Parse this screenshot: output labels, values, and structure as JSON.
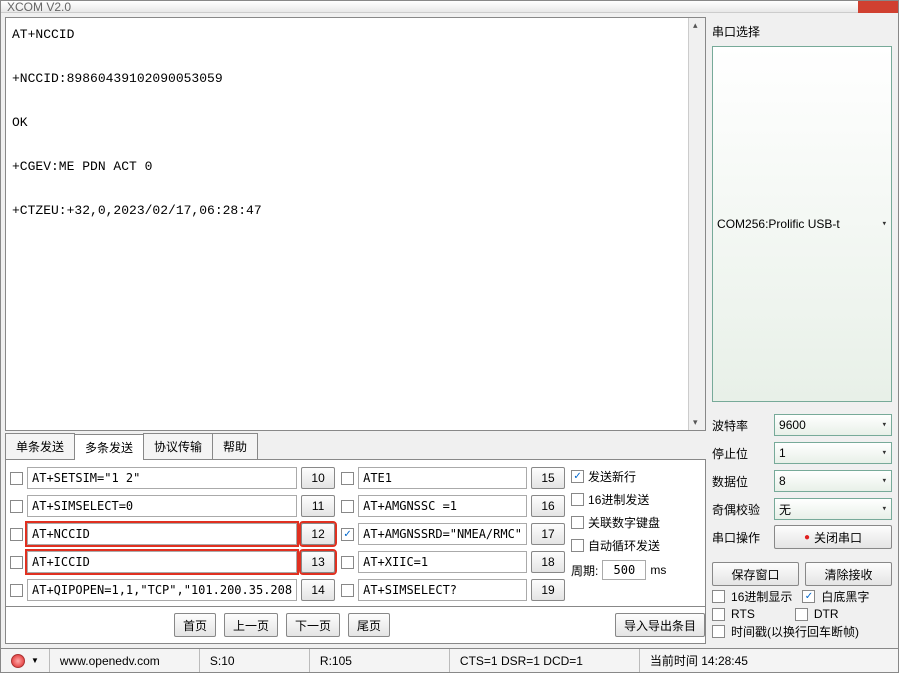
{
  "title": "XCOM V2.0",
  "output": {
    "lines": [
      "AT+NCCID",
      "+NCCID:89860439102090053059",
      "OK",
      "+CGEV:ME PDN ACT 0",
      "+CTZEU:+32,0,2023/02/17,06:28:47"
    ]
  },
  "right_panel": {
    "heading": "串口选择",
    "port": "COM256:Prolific USB-t",
    "baud_label": "波特率",
    "baud": "9600",
    "stop_label": "停止位",
    "stop": "1",
    "data_label": "数据位",
    "data": "8",
    "parity_label": "奇偶校验",
    "parity": "无",
    "op_label": "串口操作",
    "op_btn": "关闭串口",
    "save_btn": "保存窗口",
    "clear_btn": "清除接收",
    "hex_disp": "16进制显示",
    "white_bg": "白底黑字",
    "rts": "RTS",
    "dtr": "DTR",
    "timestamp": "时间戳(以换行回车断帧)"
  },
  "tabs": {
    "t0": "单条发送",
    "t1": "多条发送",
    "t2": "协议传输",
    "t3": "帮助"
  },
  "send": {
    "left": [
      {
        "cmd": "AT+SETSIM=\"1 2\"",
        "n": "10",
        "hl": false,
        "chk": false
      },
      {
        "cmd": "AT+SIMSELECT=0",
        "n": "11",
        "hl": false,
        "chk": false
      },
      {
        "cmd": "AT+NCCID",
        "n": "12",
        "hl": true,
        "chk": false
      },
      {
        "cmd": "AT+ICCID",
        "n": "13",
        "hl": true,
        "chk": false
      },
      {
        "cmd": "AT+QIPOPEN=1,1,\"TCP\",\"101.200.35.208",
        "n": "14",
        "hl": false,
        "chk": false
      }
    ],
    "right": [
      {
        "cmd": "ATE1",
        "n": "15",
        "hl": false,
        "chk": false
      },
      {
        "cmd": "AT+AMGNSSC =1",
        "n": "16",
        "hl": false,
        "chk": false
      },
      {
        "cmd": "AT+AMGNSSRD=\"NMEA/RMC\"",
        "n": "17",
        "hl": false,
        "chk": true
      },
      {
        "cmd": "AT+XIIC=1",
        "n": "18",
        "hl": false,
        "chk": false
      },
      {
        "cmd": "AT+SIMSELECT?",
        "n": "19",
        "hl": false,
        "chk": false
      }
    ]
  },
  "opts": {
    "newline": "发送新行",
    "hex_send": "16进制发送",
    "numpad": "关联数字键盘",
    "auto_loop": "自动循环发送",
    "period_label": "周期:",
    "period_val": "500",
    "period_unit": "ms"
  },
  "nav": {
    "first": "首页",
    "prev": "上一页",
    "next": "下一页",
    "last": "尾页",
    "export": "导入导出条目"
  },
  "status": {
    "url": "www.openedv.com",
    "s": "S:10",
    "r": "R:105",
    "sig": "CTS=1 DSR=1 DCD=1",
    "time": "当前时间 14:28:45"
  }
}
